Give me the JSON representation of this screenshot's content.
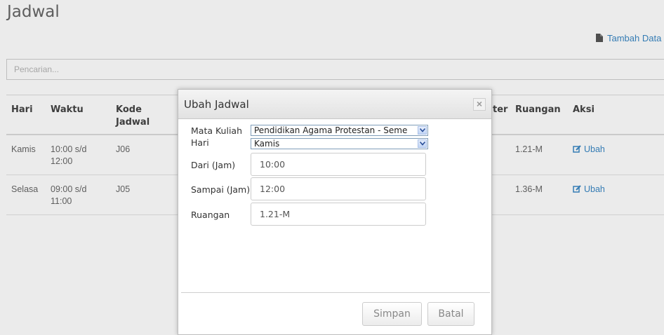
{
  "page": {
    "title": "Jadwal",
    "add_link": "Tambah Data",
    "search_placeholder": "Pencarian..."
  },
  "table": {
    "columns": [
      "Hari",
      "Waktu",
      "Kode Jadwal",
      "ter",
      "Ruangan",
      "Aksi"
    ],
    "rows": [
      {
        "hari": "Kamis",
        "waktu": "10:00 s/d 12:00",
        "kode": "J06",
        "ruangan": "1.21-M",
        "aksi": "Ubah"
      },
      {
        "hari": "Selasa",
        "waktu": "09:00 s/d 11:00",
        "kode": "J05",
        "ruangan": "1.36-M",
        "aksi": "Ubah"
      }
    ]
  },
  "modal": {
    "title": "Ubah Jadwal",
    "close": "×",
    "fields": {
      "mata_kuliah": {
        "label": "Mata Kuliah",
        "value": "Pendidikan Agama Protestan - Seme"
      },
      "hari": {
        "label": "Hari",
        "value": "Kamis"
      },
      "dari": {
        "label": "Dari (Jam)",
        "value": "10:00"
      },
      "sampai": {
        "label": "Sampai (Jam)",
        "value": "12:00"
      },
      "ruangan": {
        "label": "Ruangan",
        "value": "1.21-M"
      }
    },
    "buttons": {
      "save": "Simpan",
      "cancel": "Batal"
    }
  },
  "colors": {
    "link": "#3a87c4",
    "header_bg": "#e8e8e8"
  },
  "icons": {
    "add": "file-icon",
    "edit": "edit-icon",
    "select": "chevron-down-icon"
  }
}
